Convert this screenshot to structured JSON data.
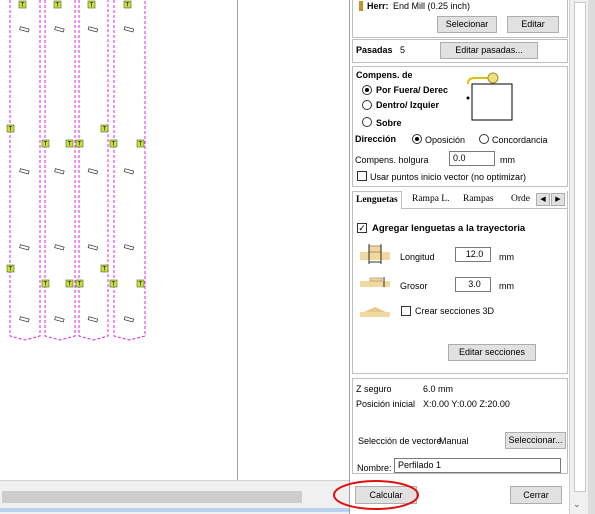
{
  "tool": {
    "label": "Herr:",
    "value": "End Mill (0.25 inch)",
    "select_button": "Selecionar",
    "edit_button": "Editar"
  },
  "passes": {
    "label": "Pasadas",
    "count": "5",
    "edit_button": "Editar pasadas..."
  },
  "offset": {
    "title": "Compens. de",
    "options": [
      "Por Fuera/ Derec",
      "Dentro/ Izquier",
      "Sobre"
    ],
    "selected": "Por Fuera/ Derec",
    "direction_label": "Dirección",
    "direction_options": [
      "Oposición",
      "Concordancia"
    ],
    "direction_selected": "Oposición",
    "allowance_label": "Compens. holgura",
    "allowance_value": "0.0",
    "allowance_unit": "mm",
    "vector_start_label": "Usar puntos inicio vector (no optimizar)"
  },
  "tabs": {
    "items": [
      "Lenguetas",
      "Rampa L.",
      "Rampas",
      "Orde"
    ],
    "active": "Lenguetas"
  },
  "tabs_panel": {
    "add_tabs_label": "Agregar lenguetas a la trayectoria",
    "length_label": "Longitud",
    "length_value": "12.0",
    "length_unit": "mm",
    "thickness_label": "Grosor",
    "thickness_value": "3.0",
    "thickness_unit": "mm",
    "create_3d_label": "Crear secciones 3D",
    "edit_button": "Editar secciones"
  },
  "info": {
    "safe_z_label": "Z seguro",
    "safe_z_value": "6.0 mm",
    "home_label": "Posición inicial",
    "home_value": "X:0.00 Y:0.00 Z:20.00"
  },
  "vector_selection": {
    "label": "Selección de vectore",
    "mode": "Manual",
    "button": "Seleccionar..."
  },
  "name": {
    "label": "Nombre:",
    "value": "Perfilado 1"
  },
  "actions": {
    "calculate": "Calcular",
    "close": "Cerrar"
  },
  "canvas": {
    "tab_marker_letter": "T"
  },
  "colors": {
    "toolpath": "#e020e0",
    "tab_marker": "#c8e040",
    "highlight": "#e01010"
  }
}
